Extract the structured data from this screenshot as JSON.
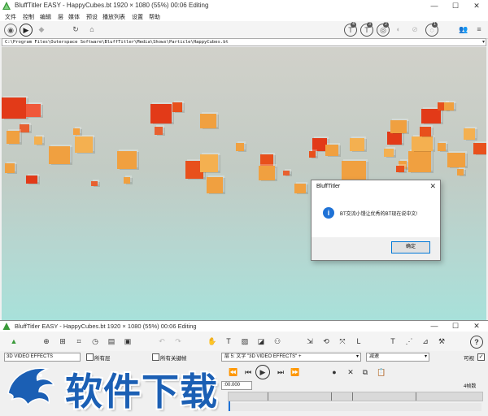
{
  "window": {
    "title": "BluffTitler EASY  -  HappyCubes.bt 1920 × 1080 (55%) 00:06 Editing",
    "controls": [
      "—",
      "☐",
      "✕"
    ]
  },
  "menu": [
    "文件",
    "控制",
    "编辑",
    "层",
    "媒体",
    "预设",
    "播放列表",
    "设置",
    "帮助"
  ],
  "toolbar": {
    "left_icons": [
      "play-circle-icon",
      "play-icon",
      "diamond-icon",
      "refresh-icon",
      "home-icon"
    ],
    "right_badges": [
      "4",
      "3",
      "2",
      "1"
    ]
  },
  "path": "C:\\Program Files\\Outerspace Software\\BluffTitler\\Media\\Shows\\Particle\\HappyCubes.bt",
  "dialog": {
    "title": "BluffTitler",
    "close": "✕",
    "message": "BT交流小馒让优秀的BT现在说中文!",
    "ok": "确定",
    "info_glyph": "i"
  },
  "bottom": {
    "title": "BluffTitler EASY  -  HappyCubes.bt 1920 × 1080 (55%) 00:06 Editing",
    "layer_name": "3D VIDEO EFFECTS",
    "all_layers": "所有层",
    "all_keyframes": "所有关键帧",
    "layer_select": "层 5: 文字 \"3D VIDEO EFFECTS\" +",
    "ease_select": "减速",
    "visible": "可视",
    "time": ":00.000",
    "frames": "4帧数",
    "help": "?"
  },
  "watermark": {
    "text": "软件下载"
  },
  "colors": {
    "accent": "#1f72d6",
    "cube_orange": "#f0a040",
    "cube_red": "#e23a18"
  }
}
